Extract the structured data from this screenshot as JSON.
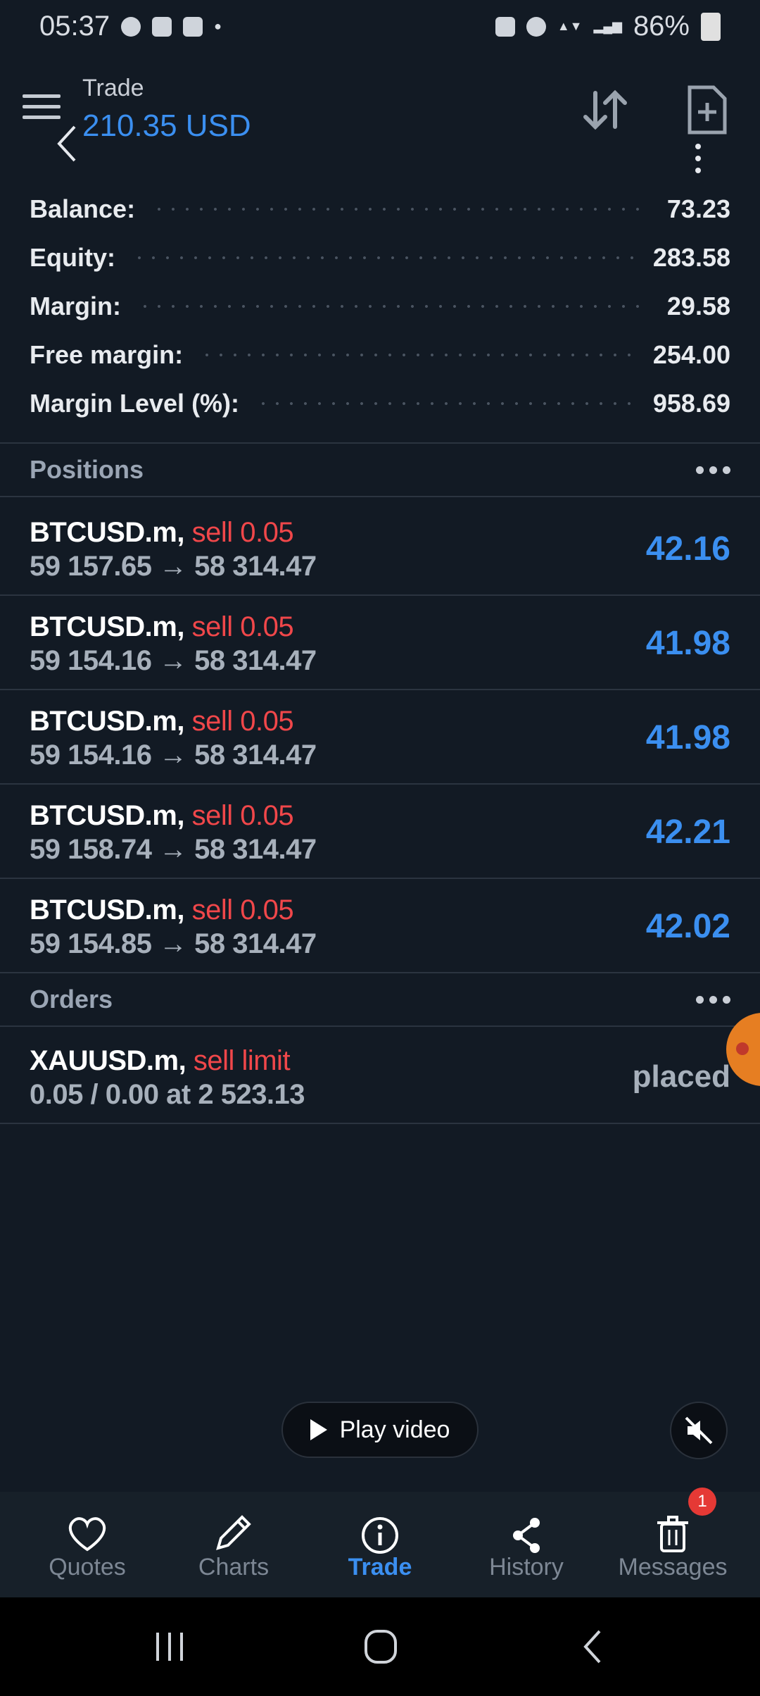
{
  "status_bar": {
    "time": "05:37",
    "battery": "86%"
  },
  "header": {
    "title": "Trade",
    "subtitle": "210.35 USD"
  },
  "summary": [
    {
      "label": "Balance:",
      "value": "73.23"
    },
    {
      "label": "Equity:",
      "value": "283.58"
    },
    {
      "label": "Margin:",
      "value": "29.58"
    },
    {
      "label": "Free margin:",
      "value": "254.00"
    },
    {
      "label": "Margin Level (%):",
      "value": "958.69"
    }
  ],
  "positions": {
    "header": "Positions",
    "items": [
      {
        "symbol": "BTCUSD.m,",
        "action": "sell 0.05",
        "prices": "59 157.65 → 58 314.47",
        "profit": "42.16"
      },
      {
        "symbol": "BTCUSD.m,",
        "action": "sell 0.05",
        "prices": "59 154.16 → 58 314.47",
        "profit": "41.98"
      },
      {
        "symbol": "BTCUSD.m,",
        "action": "sell 0.05",
        "prices": "59 154.16 → 58 314.47",
        "profit": "41.98"
      },
      {
        "symbol": "BTCUSD.m,",
        "action": "sell 0.05",
        "prices": "59 158.74 → 58 314.47",
        "profit": "42.21"
      },
      {
        "symbol": "BTCUSD.m,",
        "action": "sell 0.05",
        "prices": "59 154.85 → 58 314.47",
        "profit": "42.02"
      }
    ]
  },
  "orders": {
    "header": "Orders",
    "items": [
      {
        "symbol": "XAUUSD.m,",
        "action": "sell limit",
        "details": "0.05 / 0.00 at 2 523.13",
        "status": "placed"
      }
    ]
  },
  "video": {
    "play_label": "Play video"
  },
  "bottom_nav": [
    {
      "label": "Quotes",
      "icon": "heart-icon"
    },
    {
      "label": "Charts",
      "icon": "pencil-icon"
    },
    {
      "label": "Trade",
      "icon": "info-icon"
    },
    {
      "label": "History",
      "icon": "share-icon"
    },
    {
      "label": "Messages",
      "icon": "trash-icon",
      "badge": "1"
    }
  ],
  "colors": {
    "accent": "#3b8ff0",
    "sell": "#f0474a",
    "background": "#121a24"
  }
}
